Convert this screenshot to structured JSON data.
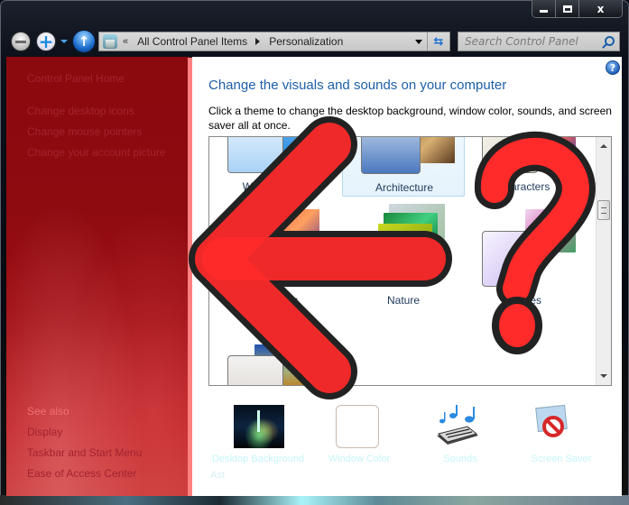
{
  "window": {
    "caption_buttons": {
      "minimize": "minimize",
      "maximize": "maximize",
      "close": "x"
    }
  },
  "nav": {
    "back_icon": "back-arrow-icon",
    "forward_icon": "forward-arrow-icon",
    "forward_glyph": "+",
    "up_glyph": "↑",
    "address": {
      "overflow": "«",
      "crumbs": [
        "All Control Panel Items",
        "Personalization"
      ]
    },
    "refresh_glyph": "⇆",
    "search_placeholder": "Search Control Panel"
  },
  "sidebar": {
    "home": "Control Panel Home",
    "links": [
      "Change desktop icons",
      "Change mouse pointers",
      "Change your account picture"
    ],
    "see_also_header": "See also",
    "see_also": [
      "Display",
      "Taskbar and Start Menu",
      "Ease of Access Center"
    ]
  },
  "main": {
    "help_glyph": "?",
    "title": "Change the visuals and sounds on your computer",
    "description": "Click a theme to change the desktop background, window color, sounds, and screen saver all at once.",
    "themes": [
      {
        "label": "Windows 7",
        "selected": false
      },
      {
        "label": "Architecture",
        "selected": true
      },
      {
        "label": "Characters",
        "selected": false
      },
      {
        "label": "Landscapes",
        "selected": false
      },
      {
        "label": "Nature",
        "selected": false
      },
      {
        "label": "Scenes",
        "selected": false
      },
      {
        "label": "",
        "selected": false
      }
    ],
    "settings": [
      {
        "label": "Desktop Background",
        "sub": "Ast"
      },
      {
        "label": "Window Color",
        "sub": ""
      },
      {
        "label": "Sounds",
        "sub": ""
      },
      {
        "label": "Screen Saver",
        "sub": ""
      }
    ]
  },
  "annotations": {
    "arrow": "left-arrow-overlay",
    "question": "question-mark-overlay",
    "fill_color": "#ff2a2a",
    "stroke_color": "#222222"
  }
}
